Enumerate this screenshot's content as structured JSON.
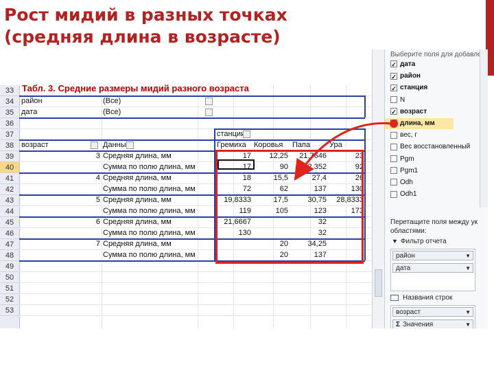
{
  "slide_title": "Рост мидий в разных точках (средняя длина в возрасте)",
  "table_title": "Табл. 3. Средние размеры мидий разного возраста",
  "row_numbers": [
    "33",
    "34",
    "35",
    "36",
    "37",
    "38",
    "39",
    "40",
    "41",
    "42",
    "43",
    "44",
    "45",
    "46",
    "47",
    "48",
    "49",
    "50",
    "51",
    "52",
    "53"
  ],
  "selected_row": "40",
  "filters": [
    {
      "name": "район",
      "value": "(Все)"
    },
    {
      "name": "дата",
      "value": "(Все)"
    }
  ],
  "column_field": "станции",
  "row_header": {
    "age": "возраст",
    "data": "Данные"
  },
  "stations": [
    "Гремиха",
    "Коровья",
    "Папа",
    "Ура"
  ],
  "blocks": [
    {
      "age": "3",
      "mean_label": "Средняя длина, мм",
      "mean": [
        "17",
        "12,25",
        "21,7646",
        "23"
      ],
      "sum_label": "Сумма по полю длина, мм",
      "sum": [
        "17",
        "90",
        "12,352",
        "92"
      ]
    },
    {
      "age": "4",
      "mean_label": "Средняя длина, мм",
      "mean": [
        "18",
        "15,5",
        "27,4",
        "26"
      ],
      "sum_label": "Сумма по полю длина, мм",
      "sum": [
        "72",
        "62",
        "137",
        "130"
      ]
    },
    {
      "age": "5",
      "mean_label": "Средняя длина, мм",
      "mean": [
        "19,8333",
        "17,5",
        "30,75",
        "28,8333"
      ],
      "sum_label": "Сумма по полю длина, мм",
      "sum": [
        "119",
        "105",
        "123",
        "173"
      ]
    },
    {
      "age": "6",
      "mean_label": "Средняя длина, мм",
      "mean": [
        "21,6667",
        "",
        "32",
        ""
      ],
      "sum_label": "Сумма по полю длина, мм",
      "sum": [
        "130",
        "",
        "32",
        ""
      ]
    },
    {
      "age": "7",
      "mean_label": "Средняя длина, мм",
      "mean": [
        "",
        "20",
        "34,25",
        ""
      ],
      "sum_label": "Сумма по полю длина, мм",
      "sum": [
        "",
        "20",
        "137",
        ""
      ]
    }
  ],
  "field_list": {
    "header": "Выберите поля для добавле",
    "fields": [
      {
        "label": "дата",
        "checked": true
      },
      {
        "label": "район",
        "checked": true
      },
      {
        "label": "станция",
        "checked": true
      },
      {
        "label": "N",
        "checked": false
      },
      {
        "label": "возраст",
        "checked": true
      },
      {
        "label": "длина, мм",
        "checked": false
      },
      {
        "label": "вес, г",
        "checked": false
      },
      {
        "label": "Вес восстановленный",
        "checked": false
      },
      {
        "label": "Pgm",
        "checked": false
      },
      {
        "label": "Pgm1",
        "checked": false
      },
      {
        "label": "Odh",
        "checked": false
      },
      {
        "label": "Odh1",
        "checked": false
      }
    ],
    "drag_hint_1": "Перетащите поля между ук",
    "drag_hint_2": "областями:",
    "filter_area_label": "Фильтр отчета",
    "filter_area_items": [
      "район",
      "дата"
    ],
    "row_area_label": "Названия строк",
    "row_area_items": [
      "возраст",
      "Значения"
    ],
    "sigma_glyph": "Σ"
  },
  "colors": {
    "title": "#b52121",
    "highlight": "#e0241b",
    "pivot_border": "#2a3fa8",
    "panel_highlight": "#fce7a5"
  }
}
